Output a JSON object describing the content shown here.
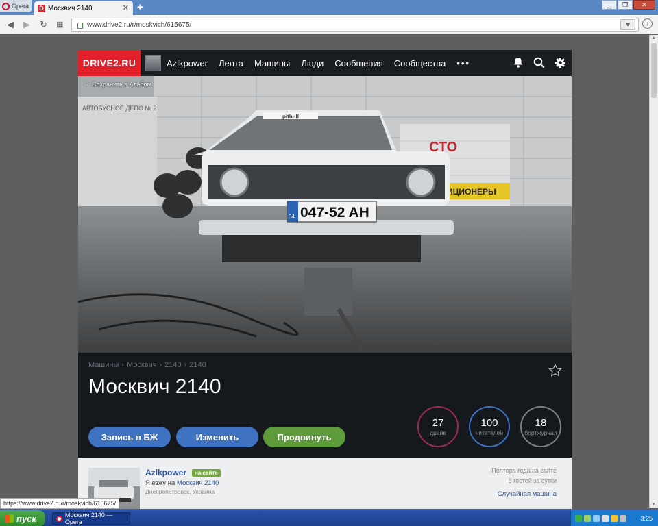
{
  "browser": {
    "opera_label": "Opera",
    "tab_title": "Москвич 2140",
    "tab_favicon": "D",
    "url": "www.drive2.ru/r/moskvich/615675/",
    "status_url": "https://www.drive2.ru/r/moskvich/615675/"
  },
  "site": {
    "logo": "DRIVE2.RU",
    "nav": {
      "username": "Azlkpower",
      "items": [
        "Лента",
        "Машины",
        "Люди",
        "Сообщения",
        "Сообщества"
      ],
      "more": "•••"
    },
    "photo": {
      "save_album": "Сохранить в Альбом",
      "license_plate": "047-52 AH",
      "plate_region": "04",
      "sign_sto": "СТО",
      "sign_conditioners": "ИЦИОНЕРЫ",
      "sign_depot": "АВТОБУСНОЕ ДЕПО № 2",
      "windshield_banner": "pitbull"
    },
    "breadcrumbs": [
      "Машины",
      "Москвич",
      "2140",
      "2140"
    ],
    "breadcrumb_sep": "›",
    "car_title": "Москвич 2140",
    "buttons": {
      "journal": "Запись в БЖ",
      "edit": "Изменить",
      "promote": "Продвинуть"
    },
    "stats": [
      {
        "value": "27",
        "label": "драйв"
      },
      {
        "value": "100",
        "label": "читателей"
      },
      {
        "value": "18",
        "label": "бортжурнал"
      }
    ],
    "profile": {
      "name": "Azlkpower",
      "online_badge": "на сайте",
      "drives_prefix": "Я езжу на",
      "drives_car": "Москвич 2140",
      "city": "Днепропетровск, Украина",
      "since": "Полтора года на сайте",
      "guests": "8 гостей за сутки",
      "random_car": "Случайная машина"
    }
  },
  "taskbar": {
    "start": "пуск",
    "task": "Москвич 2140 — Opera",
    "clock": "3:25"
  },
  "colors": {
    "brand_red": "#e2212b",
    "button_blue": "#3f72c1",
    "button_green": "#5e9c3b",
    "link_blue": "#3056a0"
  }
}
